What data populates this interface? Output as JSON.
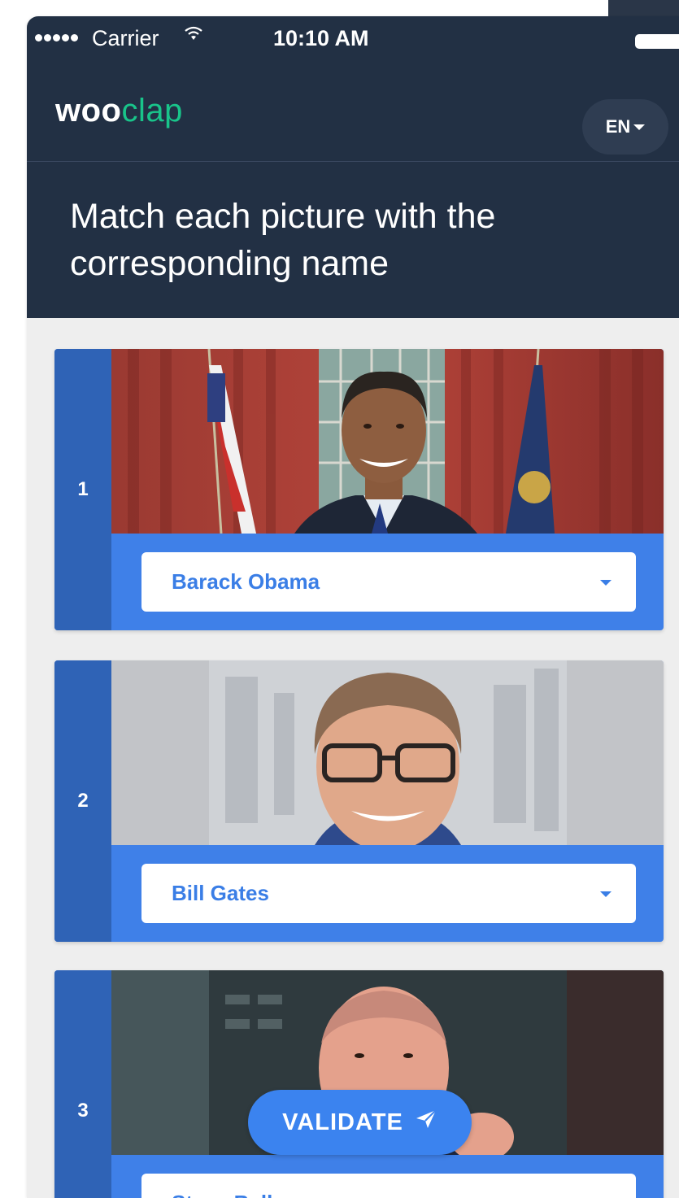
{
  "status_bar": {
    "carrier": "Carrier",
    "time": "10:10 AM",
    "icons": [
      "signal-dots-icon",
      "wifi-icon",
      "battery-icon"
    ]
  },
  "app_bar": {
    "logo_part1": "woo",
    "logo_part2": "clap",
    "language": "EN"
  },
  "question": {
    "text": "Match each picture with the corresponding name"
  },
  "cards": [
    {
      "number": "1",
      "selected": "Barack Obama"
    },
    {
      "number": "2",
      "selected": "Bill Gates"
    },
    {
      "number": "3",
      "selected": "Steve Ballmer"
    }
  ],
  "actions": {
    "validate_label": "VALIDATE",
    "validate_icon": "send-icon"
  },
  "colors": {
    "header_bg": "#223044",
    "accent_green": "#19c48a",
    "card_blue": "#3f80e8",
    "card_number_blue": "#2f63b6",
    "background": "#eeeeee"
  }
}
